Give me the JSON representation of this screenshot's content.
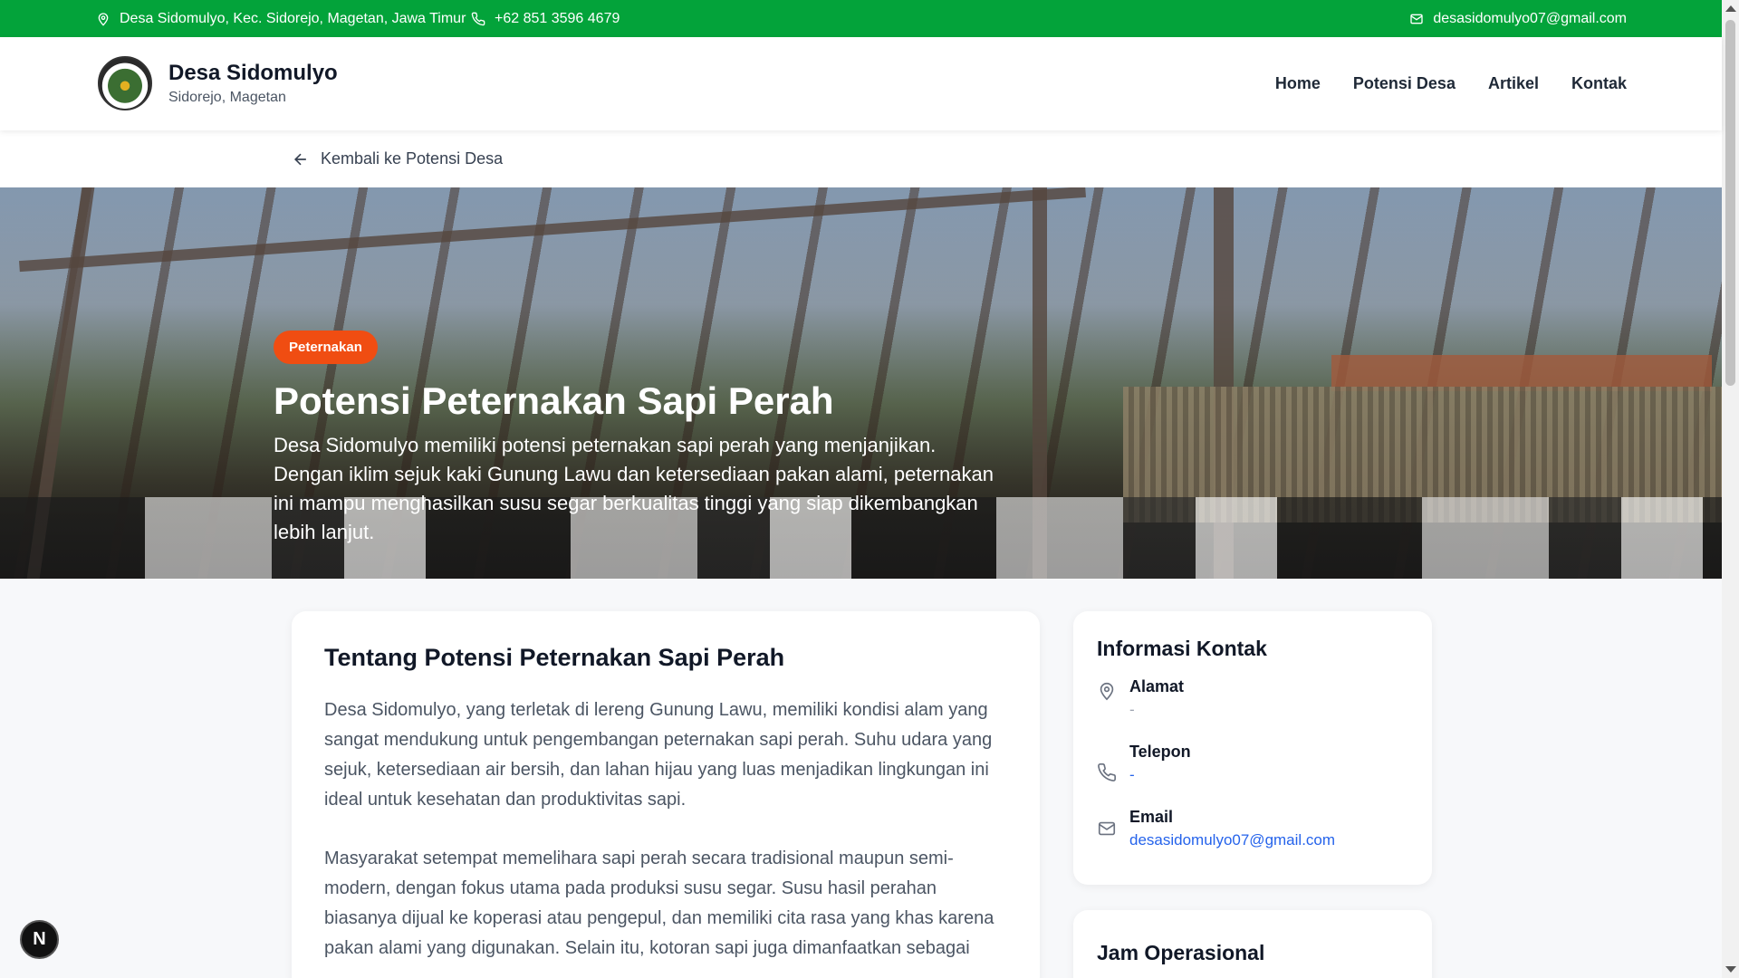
{
  "topbar": {
    "address": "Desa Sidomulyo, Kec. Sidorejo, Magetan, Jawa Timur",
    "phone": "+62 851 3596 4679",
    "email": "desasidomulyo07@gmail.com"
  },
  "header": {
    "site_name": "Desa Sidomulyo",
    "site_subtitle": "Sidorejo, Magetan",
    "nav": [
      "Home",
      "Potensi Desa",
      "Artikel",
      "Kontak"
    ]
  },
  "back_link": "Kembali ke Potensi Desa",
  "hero": {
    "badge": "Peternakan",
    "title": "Potensi Peternakan Sapi Perah",
    "description": "Desa Sidomulyo memiliki potensi peternakan sapi perah yang menjanjikan. Dengan iklim sejuk kaki Gunung Lawu dan ketersediaan pakan alami, peternakan ini mampu menghasilkan susu segar berkualitas tinggi yang siap dikembangkan lebih lanjut."
  },
  "main": {
    "heading": "Tentang Potensi Peternakan Sapi Perah",
    "paragraphs": [
      "Desa Sidomulyo, yang terletak di lereng Gunung Lawu, memiliki kondisi alam yang sangat mendukung untuk pengembangan peternakan sapi perah. Suhu udara yang sejuk, ketersediaan air bersih, dan lahan hijau yang luas menjadikan lingkungan ini ideal untuk kesehatan dan produktivitas sapi.",
      "Masyarakat setempat memelihara sapi perah secara tradisional maupun semi-modern, dengan fokus utama pada produksi susu segar. Susu hasil perahan biasanya dijual ke koperasi atau pengepul, dan memiliki cita rasa yang khas karena pakan alami yang digunakan. Selain itu, kotoran sapi juga dimanfaatkan sebagai"
    ]
  },
  "sidebar": {
    "contact_title": "Informasi Kontak",
    "address_label": "Alamat",
    "address_value": "-",
    "phone_label": "Telepon",
    "phone_value": "-",
    "email_label": "Email",
    "email_value": "desasidomulyo07@gmail.com",
    "hours_title": "Jam Operasional"
  },
  "dev_badge": "N",
  "colors": {
    "topbar": "#03a33a",
    "badge": "#f04d12",
    "link": "#2563eb"
  }
}
